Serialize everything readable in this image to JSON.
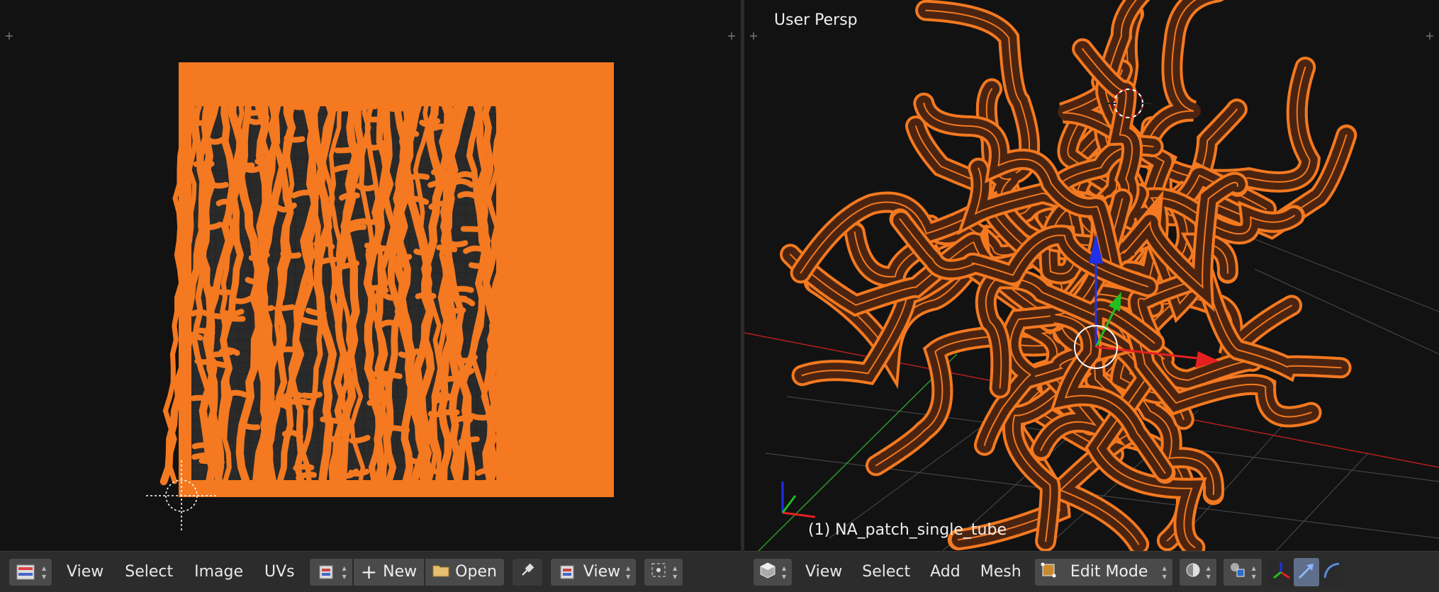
{
  "left_editor": {
    "name": "UV/Image Editor",
    "menu": [
      "View",
      "Select",
      "Image",
      "UVs"
    ],
    "new_label": "New",
    "open_label": "Open",
    "view_label": "View"
  },
  "right_editor": {
    "name": "3D View",
    "viewport_label": "User Persp",
    "object_label": "(1) NA_patch_single_tube",
    "menu": [
      "View",
      "Select",
      "Add",
      "Mesh"
    ],
    "mode_label": "Edit Mode"
  },
  "colors": {
    "uv_orange": "#f47920",
    "background": "#121212",
    "header": "#2c2c2c",
    "axis_x": "#e62020",
    "axis_y": "#20c020",
    "axis_z": "#2030e6"
  }
}
